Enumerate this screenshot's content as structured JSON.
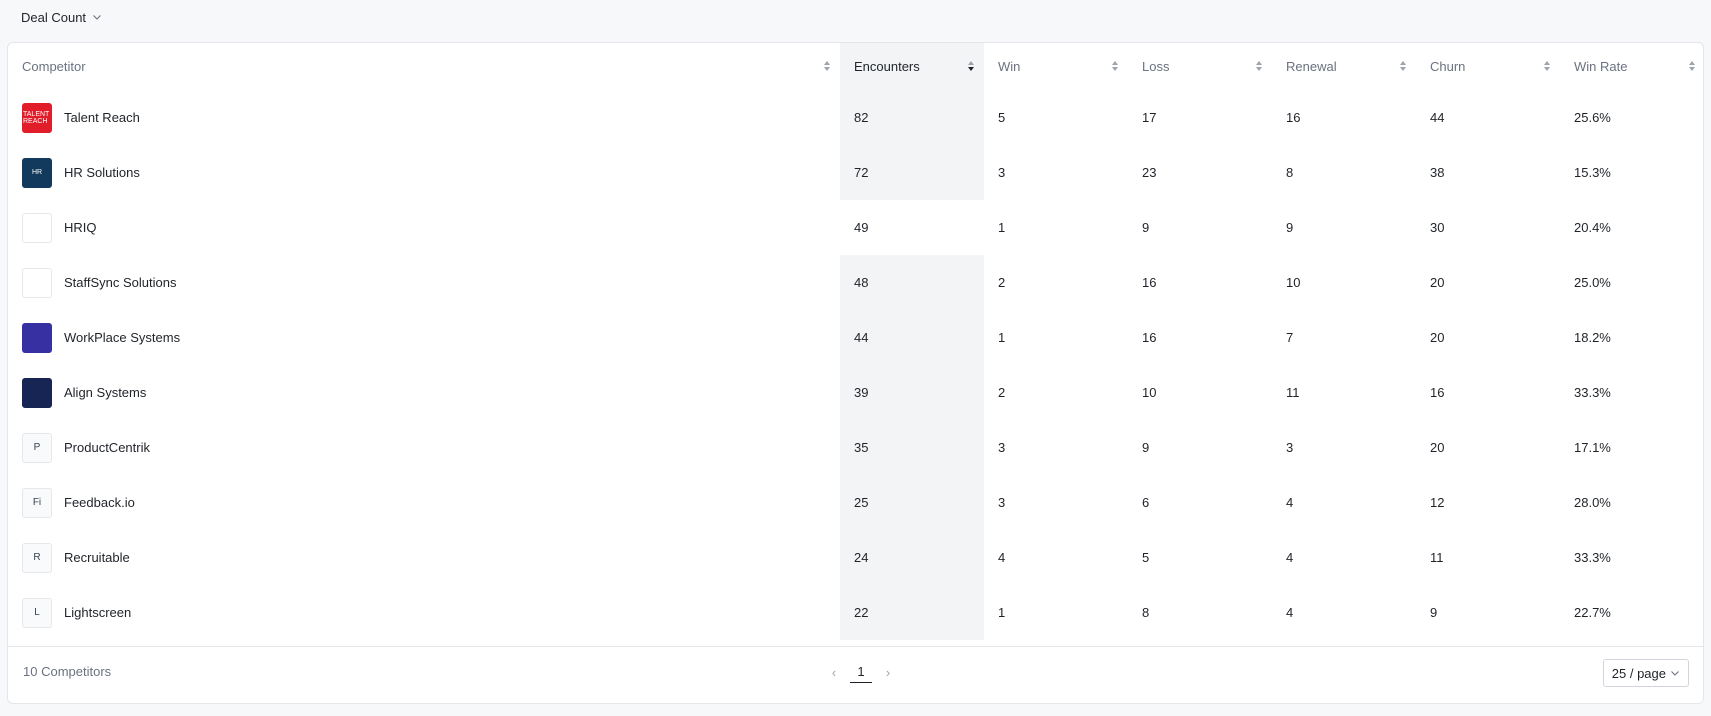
{
  "metric_selector": {
    "label": "Deal Count",
    "icon": "chevron-down-icon"
  },
  "table": {
    "columns": [
      "Competitor",
      "Encounters",
      "Win",
      "Loss",
      "Renewal",
      "Churn",
      "Win Rate"
    ],
    "active_sort_column": "Encounters",
    "rows": [
      {
        "name": "Talent Reach",
        "logo_text": "TALENT REACH",
        "logo_color": "#e11d2a",
        "encounters": "82",
        "win": "5",
        "loss": "17",
        "renewal": "16",
        "churn": "44",
        "win_rate": "25.6%"
      },
      {
        "name": "HR Solutions",
        "logo_text": "HR",
        "logo_color": "#123a5c",
        "encounters": "72",
        "win": "3",
        "loss": "23",
        "renewal": "8",
        "churn": "38",
        "win_rate": "15.3%"
      },
      {
        "name": "HRIQ",
        "logo_text": "",
        "logo_color": "#ffffff",
        "encounters": "49",
        "win": "1",
        "loss": "9",
        "renewal": "9",
        "churn": "30",
        "win_rate": "20.4%"
      },
      {
        "name": "StaffSync Solutions",
        "logo_text": "",
        "logo_color": "#ffffff",
        "encounters": "48",
        "win": "2",
        "loss": "16",
        "renewal": "10",
        "churn": "20",
        "win_rate": "25.0%"
      },
      {
        "name": "WorkPlace Systems",
        "logo_text": "",
        "logo_color": "#3730a3",
        "encounters": "44",
        "win": "1",
        "loss": "16",
        "renewal": "7",
        "churn": "20",
        "win_rate": "18.2%"
      },
      {
        "name": "Align Systems",
        "logo_text": "",
        "logo_color": "#172554",
        "encounters": "39",
        "win": "2",
        "loss": "10",
        "renewal": "11",
        "churn": "16",
        "win_rate": "33.3%"
      },
      {
        "name": "ProductCentrik",
        "logo_text": "P",
        "logo_color": "#f9fafb",
        "encounters": "35",
        "win": "3",
        "loss": "9",
        "renewal": "3",
        "churn": "20",
        "win_rate": "17.1%"
      },
      {
        "name": "Feedback.io",
        "logo_text": "Fi",
        "logo_color": "#f9fafb",
        "encounters": "25",
        "win": "3",
        "loss": "6",
        "renewal": "4",
        "churn": "12",
        "win_rate": "28.0%"
      },
      {
        "name": "Recruitable",
        "logo_text": "R",
        "logo_color": "#f9fafb",
        "encounters": "24",
        "win": "4",
        "loss": "5",
        "renewal": "4",
        "churn": "11",
        "win_rate": "33.3%"
      },
      {
        "name": "Lightscreen",
        "logo_text": "L",
        "logo_color": "#f9fafb",
        "encounters": "22",
        "win": "1",
        "loss": "8",
        "renewal": "4",
        "churn": "9",
        "win_rate": "22.7%"
      }
    ]
  },
  "footer": {
    "count_label": "10 Competitors",
    "current_page": "1",
    "page_size_label": "25 / page"
  }
}
